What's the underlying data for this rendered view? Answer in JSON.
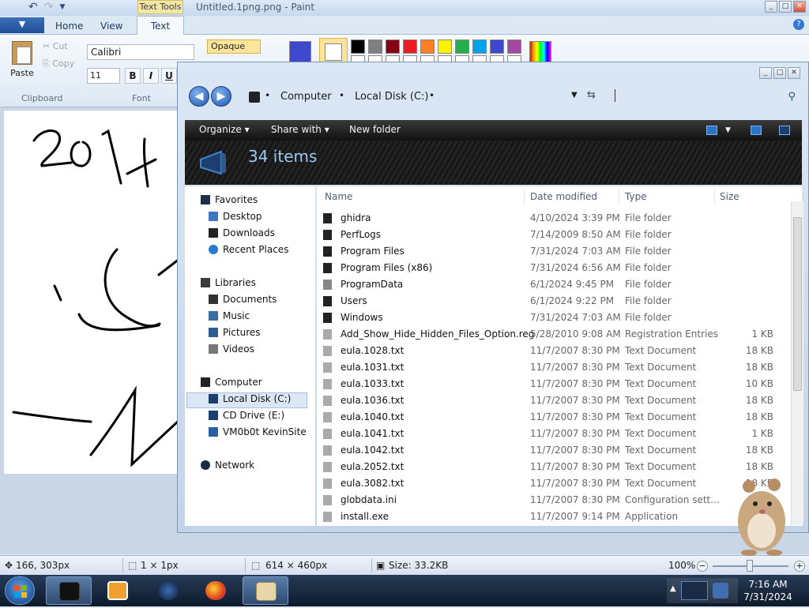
{
  "paint": {
    "title": "Untitled.1png.png - Paint",
    "contextual_tab": "Text Tools",
    "file_menu": "▼",
    "tabs": [
      "Home",
      "View",
      "Text"
    ],
    "clipboard": {
      "paste": "Paste",
      "cut": "Cut",
      "copy": "Copy",
      "group": "Clipboard"
    },
    "font": {
      "family": "Calibri",
      "size": "11",
      "bold": "B",
      "italic": "I",
      "underline": "U",
      "group": "Font"
    },
    "background_mode": "Opaque",
    "palette": [
      "#000000",
      "#7f7f7f",
      "#880015",
      "#ed1c24",
      "#ff7f27",
      "#fff200",
      "#22b14c",
      "#00a2e8",
      "#3f48cc",
      "#a349a4"
    ],
    "color1": "#3f48cc",
    "color2": "#ffffff",
    "status": {
      "cursor_pos": "166, 303px",
      "selection_size": "1 × 1px",
      "image_size": "614 × 460px",
      "file_size": "Size: 33.2KB",
      "zoom": "100%"
    }
  },
  "explorer": {
    "breadcrumb": [
      "Computer",
      "Local Disk (C:)"
    ],
    "toolbar": {
      "organize": "Organize",
      "share_with": "Share with",
      "new_folder": "New folder"
    },
    "items_count": "34 items",
    "columns": {
      "name": "Name",
      "date": "Date modified",
      "type": "Type",
      "size": "Size"
    },
    "nav": {
      "favorites": "Favorites",
      "favorites_items": [
        "Desktop",
        "Downloads",
        "Recent Places"
      ],
      "libraries": "Libraries",
      "libraries_items": [
        "Documents",
        "Music",
        "Pictures",
        "Videos"
      ],
      "computer": "Computer",
      "computer_items": [
        "Local Disk (C:)",
        "CD Drive (E:)",
        "VM0b0t KevinSite"
      ],
      "network": "Network"
    },
    "files": [
      {
        "name": "ghidra",
        "date": "4/10/2024 3:39 PM",
        "type": "File folder",
        "size": ""
      },
      {
        "name": "PerfLogs",
        "date": "7/14/2009 8:50 AM",
        "type": "File folder",
        "size": ""
      },
      {
        "name": "Program Files",
        "date": "7/31/2024 7:03 AM",
        "type": "File folder",
        "size": ""
      },
      {
        "name": "Program Files (x86)",
        "date": "7/31/2024 6:56 AM",
        "type": "File folder",
        "size": ""
      },
      {
        "name": "ProgramData",
        "date": "6/1/2024 9:45 PM",
        "type": "File folder",
        "size": ""
      },
      {
        "name": "Users",
        "date": "6/1/2024 9:22 PM",
        "type": "File folder",
        "size": ""
      },
      {
        "name": "Windows",
        "date": "7/31/2024 7:03 AM",
        "type": "File folder",
        "size": ""
      },
      {
        "name": "Add_Show_Hide_Hidden_Files_Option.reg",
        "date": "5/28/2010 9:08 AM",
        "type": "Registration Entries",
        "size": "1 KB"
      },
      {
        "name": "eula.1028.txt",
        "date": "11/7/2007 8:30 PM",
        "type": "Text Document",
        "size": "18 KB"
      },
      {
        "name": "eula.1031.txt",
        "date": "11/7/2007 8:30 PM",
        "type": "Text Document",
        "size": "18 KB"
      },
      {
        "name": "eula.1033.txt",
        "date": "11/7/2007 8:30 PM",
        "type": "Text Document",
        "size": "10 KB"
      },
      {
        "name": "eula.1036.txt",
        "date": "11/7/2007 8:30 PM",
        "type": "Text Document",
        "size": "18 KB"
      },
      {
        "name": "eula.1040.txt",
        "date": "11/7/2007 8:30 PM",
        "type": "Text Document",
        "size": "18 KB"
      },
      {
        "name": "eula.1041.txt",
        "date": "11/7/2007 8:30 PM",
        "type": "Text Document",
        "size": "1 KB"
      },
      {
        "name": "eula.1042.txt",
        "date": "11/7/2007 8:30 PM",
        "type": "Text Document",
        "size": "18 KB"
      },
      {
        "name": "eula.2052.txt",
        "date": "11/7/2007 8:30 PM",
        "type": "Text Document",
        "size": "18 KB"
      },
      {
        "name": "eula.3082.txt",
        "date": "11/7/2007 8:30 PM",
        "type": "Text Document",
        "size": "18 KB"
      },
      {
        "name": "globdata.ini",
        "date": "11/7/2007 8:30 PM",
        "type": "Configuration sett...",
        "size": ""
      },
      {
        "name": "install.exe",
        "date": "11/7/2007 9:14 PM",
        "type": "Application",
        "size": ""
      }
    ]
  },
  "taskbar": {
    "time": "7:16 AM",
    "date": "7/31/2024",
    "tasks": [
      "explorer-icon",
      "media-player-icon",
      "globe-icon",
      "firefox-icon",
      "paint-icon"
    ]
  }
}
